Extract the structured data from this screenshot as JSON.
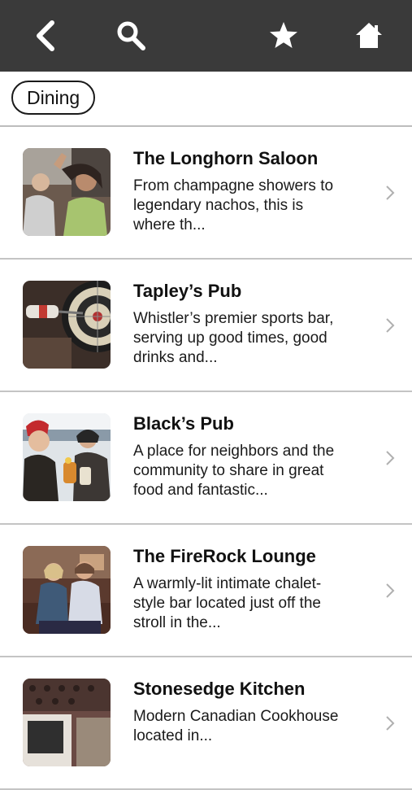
{
  "toolbar": {
    "back_icon": "chevron-left-icon",
    "search_icon": "search-icon",
    "favorite_icon": "star-icon",
    "home_icon": "home-icon",
    "bg_color": "#3a3a3a"
  },
  "filter": {
    "chip_label": "Dining"
  },
  "venues": [
    {
      "name": "The Longhorn Saloon",
      "description": "From champagne showers to legendary nachos, this is where th...",
      "image": "friends-celebrating-photo"
    },
    {
      "name": "Tapley’s Pub",
      "description": "Whistler’s premier sports bar, serving up good times, good drinks and...",
      "image": "darts-board-photo"
    },
    {
      "name": "Black’s Pub",
      "description": "A place for neighbors and the community to share in great food and fantastic...",
      "image": "friends-toasting-drinks-photo"
    },
    {
      "name": "The FireRock Lounge",
      "description": "A warmly-lit intimate chalet-style bar located just off the stroll in the...",
      "image": "couple-lounge-photo"
    },
    {
      "name": "Stonesedge Kitchen",
      "description": "Modern Canadian Cookhouse located in...",
      "image": "restaurant-interior-photo"
    }
  ]
}
